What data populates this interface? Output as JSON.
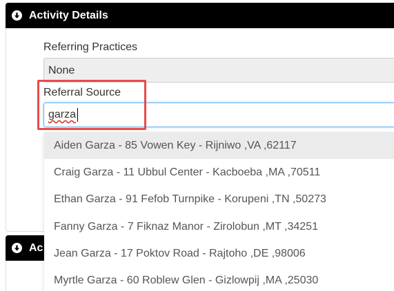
{
  "sections": {
    "activity_details": {
      "title": "Activity Details"
    },
    "second": {
      "title_visible": "Ac"
    }
  },
  "fields": {
    "referring_practices": {
      "label": "Referring Practices",
      "value": "None"
    },
    "referral_source": {
      "label": "Referral Source",
      "value": "garza"
    }
  },
  "dropdown": {
    "items": [
      "Aiden Garza - 85 Vowen Key - Rijniwo ,VA ,62117",
      "Craig Garza - 11 Ubbul Center - Kacboeba ,MA ,70511",
      "Ethan Garza - 91 Fefob Turnpike - Korupeni ,TN ,50273",
      "Fanny Garza - 7 Fiknaz Manor - Zirolobun ,MT ,34251",
      "Jean Garza - 17 Poktov Road - Rajtoho ,DE ,98006",
      "Myrtle Garza - 60 Roblew Glen - Gizlowpij ,MA ,25030"
    ]
  },
  "icons": {
    "section_toggle": "arrow-down-circle-icon"
  },
  "colors": {
    "header_bg": "#000000",
    "highlight": "#e84a4a",
    "focus_border": "#66afe9",
    "active_item_bg": "#ebebeb"
  }
}
